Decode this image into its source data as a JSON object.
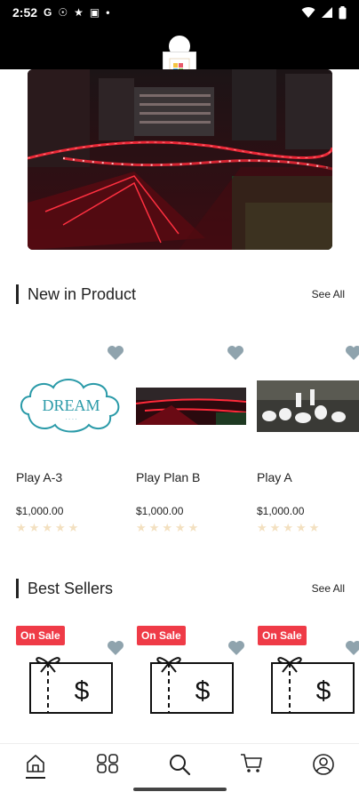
{
  "status_bar": {
    "time": "2:52",
    "glyphs": [
      "G",
      "☉",
      "★",
      "▣",
      "•"
    ]
  },
  "app": {
    "brand_color": "#000000"
  },
  "new_products": {
    "title": "New in Product",
    "see_all": "See All",
    "items": [
      {
        "name": "Play A-3",
        "price": "$1,000.00",
        "rating": 0,
        "image": "dream-cloud-logo"
      },
      {
        "name": "Play Plan B",
        "price": "$1,000.00",
        "rating": 0,
        "image": "red-lights-night-photo"
      },
      {
        "name": "Play A",
        "price": "$1,000.00",
        "rating": 0,
        "image": "white-lanterns-photo"
      }
    ]
  },
  "best_sellers": {
    "title": "Best Sellers",
    "see_all": "See All",
    "items": [
      {
        "badge": "On Sale",
        "image": "gift-dollar-icon"
      },
      {
        "badge": "On Sale",
        "image": "gift-dollar-icon"
      },
      {
        "badge": "On Sale",
        "image": "gift-dollar-icon"
      }
    ]
  },
  "bottom_nav": {
    "items": [
      "home-icon",
      "categories-icon",
      "search-icon",
      "cart-icon",
      "profile-icon"
    ],
    "active": "home-icon"
  },
  "colors": {
    "heart": "#8fa3ad",
    "sale": "#ef3b47",
    "star": "#f3e0c0"
  }
}
